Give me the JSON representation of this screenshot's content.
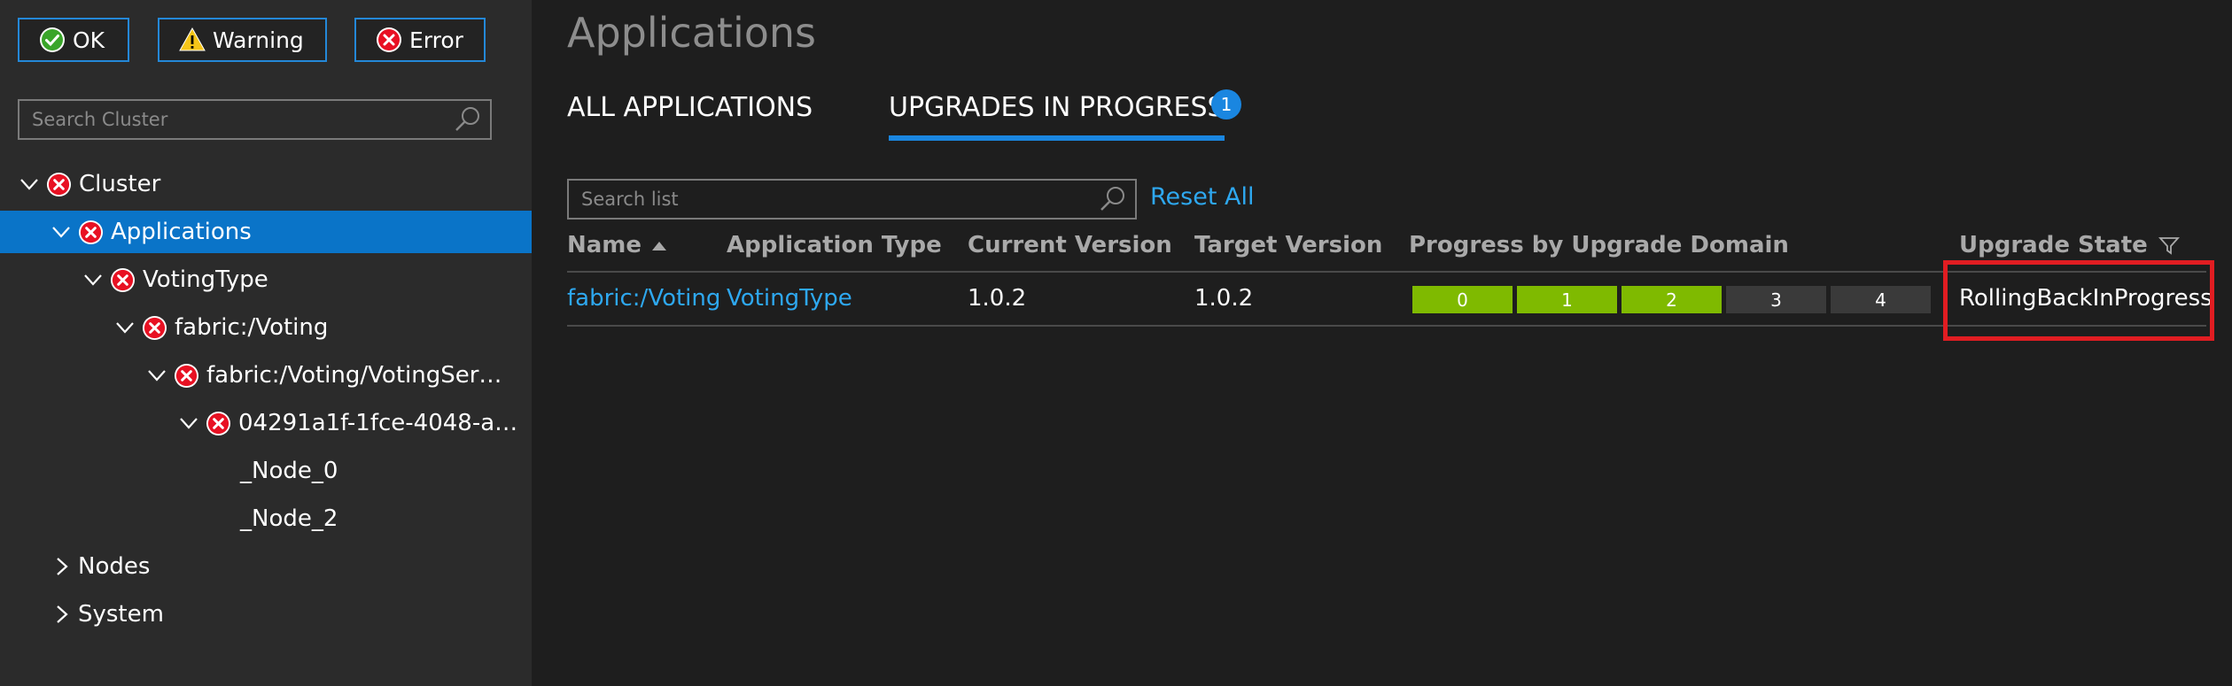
{
  "filters": {
    "ok": "OK",
    "warning": "Warning",
    "error": "Error"
  },
  "sidebar": {
    "search_placeholder": "Search Cluster",
    "tree": [
      {
        "label": "Cluster",
        "status": "error"
      },
      {
        "label": "Applications",
        "status": "error",
        "selected": true
      },
      {
        "label": "VotingType",
        "status": "error"
      },
      {
        "label": "fabric:/Voting",
        "status": "error"
      },
      {
        "label": "fabric:/Voting/VotingSer…",
        "status": "error"
      },
      {
        "label": "04291a1f-1fce-4048-a…",
        "status": "error"
      },
      {
        "label": "_Node_0"
      },
      {
        "label": "_Node_2"
      },
      {
        "label": "Nodes"
      },
      {
        "label": "System"
      }
    ]
  },
  "main": {
    "title": "Applications",
    "tabs": [
      {
        "label": "ALL APPLICATIONS"
      },
      {
        "label": "UPGRADES IN PROGRESS",
        "badge": "1",
        "active": true
      }
    ],
    "search_placeholder": "Search list",
    "reset_label": "Reset All",
    "columns": [
      "Name",
      "Application Type",
      "Current Version",
      "Target Version",
      "Progress by Upgrade Domain",
      "Upgrade State"
    ],
    "rows": [
      {
        "name": "fabric:/Voting",
        "type": "VotingType",
        "current_version": "1.0.2",
        "target_version": "1.0.2",
        "upgrade_domains": [
          {
            "label": "0",
            "done": true
          },
          {
            "label": "1",
            "done": true
          },
          {
            "label": "2",
            "done": true
          },
          {
            "label": "3",
            "done": false
          },
          {
            "label": "4",
            "done": false
          }
        ],
        "upgrade_state": "RollingBackInProgress"
      }
    ]
  },
  "colors": {
    "accent": "#0a74c8",
    "link": "#2ea8f0",
    "domain_done": "#7fba00",
    "domain_pending": "#3a3a3a",
    "error": "#e81123",
    "highlight": "#e11d22"
  },
  "icons": {
    "ok": "check-circle-icon",
    "warning": "warning-triangle-icon",
    "error": "error-circle-icon",
    "search": "search-icon",
    "expanded": "chevron-down-icon",
    "collapsed": "chevron-right-icon",
    "sort": "sort-ascending-icon",
    "filter": "filter-icon"
  }
}
